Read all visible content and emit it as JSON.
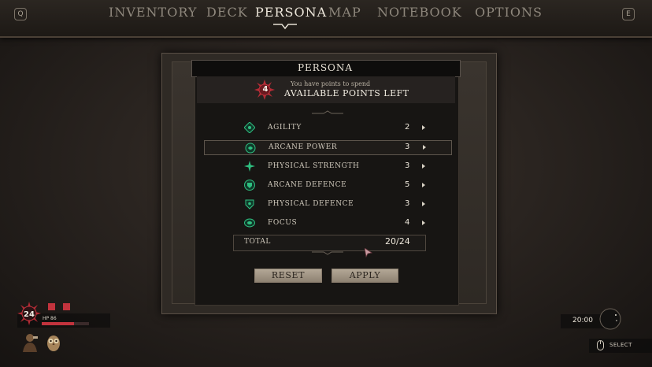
{
  "nav": {
    "left_key": "Q",
    "right_key": "E",
    "tabs": [
      {
        "label": "INVENTORY",
        "active": false
      },
      {
        "label": "DECK",
        "active": false
      },
      {
        "label": "PERSONA",
        "active": true
      },
      {
        "label": "MAP",
        "active": false
      },
      {
        "label": "NOTEBOOK",
        "active": false
      },
      {
        "label": "OPTIONS",
        "active": false
      }
    ]
  },
  "panel": {
    "title": "PERSONA",
    "points_badge": "4",
    "points_subtitle": "You have points to spend",
    "points_heading": "AVAILABLE POINTS LEFT",
    "stats": [
      {
        "label": "AGILITY",
        "value": "2",
        "icon": "agility-icon",
        "selected": false
      },
      {
        "label": "ARCANE POWER",
        "value": "3",
        "icon": "arcane-power-icon",
        "selected": true
      },
      {
        "label": "PHYSICAL STRENGTH",
        "value": "3",
        "icon": "physical-strength-icon",
        "selected": false
      },
      {
        "label": "ARCANE DEFENCE",
        "value": "5",
        "icon": "arcane-defence-icon",
        "selected": false
      },
      {
        "label": "PHYSICAL DEFENCE",
        "value": "3",
        "icon": "physical-defence-icon",
        "selected": false
      },
      {
        "label": "FOCUS",
        "value": "4",
        "icon": "focus-icon",
        "selected": false
      }
    ],
    "total_label": "TOTAL",
    "total_value": "20/24",
    "reset_label": "RESET",
    "apply_label": "APPLY"
  },
  "hud": {
    "level": "24",
    "hp_label": "HP 86",
    "hp_fraction": 0.68,
    "time": "20:00",
    "select_label": "SELECT"
  },
  "colors": {
    "accent_green": "#2fbf80",
    "accent_red": "#c2333d",
    "button": "#a79b8a"
  }
}
